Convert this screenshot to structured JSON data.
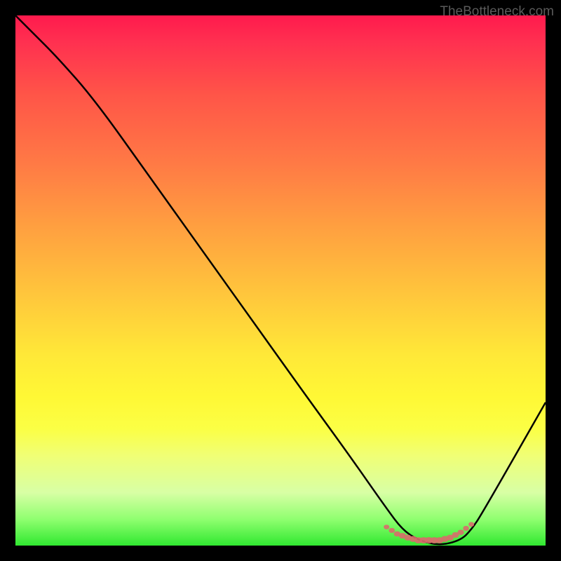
{
  "watermark": "TheBottleneck.com",
  "chart_data": {
    "type": "line",
    "title": "",
    "xlabel": "",
    "ylabel": "",
    "xlim": [
      0,
      100
    ],
    "ylim": [
      0,
      100
    ],
    "series": [
      {
        "name": "bottleneck-curve",
        "color": "#000000",
        "x": [
          0,
          3,
          8,
          15,
          25,
          35,
          45,
          55,
          63,
          70,
          73,
          76,
          80,
          84,
          86,
          88,
          100
        ],
        "values": [
          100,
          97,
          92,
          84,
          70,
          56,
          42,
          28,
          17,
          7,
          3,
          1,
          0,
          1,
          3,
          6,
          27
        ]
      },
      {
        "name": "optimal-range",
        "color": "#d96666",
        "x": [
          70,
          72,
          74,
          76,
          78,
          80,
          82,
          84,
          86
        ],
        "values": [
          3.5,
          2.2,
          1.5,
          1,
          1,
          1,
          1.5,
          2.5,
          4
        ]
      }
    ],
    "gradient_stops": [
      {
        "pct": 0,
        "color": "#ff1a4d"
      },
      {
        "pct": 15,
        "color": "#ff5548"
      },
      {
        "pct": 40,
        "color": "#ffa040"
      },
      {
        "pct": 64,
        "color": "#ffe838"
      },
      {
        "pct": 83,
        "color": "#f0ff75"
      },
      {
        "pct": 100,
        "color": "#30e830"
      }
    ]
  }
}
